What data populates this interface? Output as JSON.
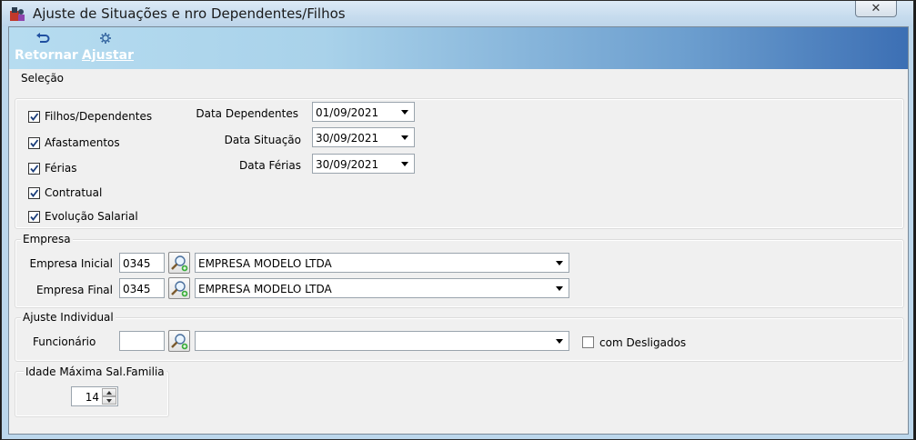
{
  "window": {
    "title": "Ajuste de Situações e nro Dependentes/Filhos",
    "close_glyph": "✕"
  },
  "toolbar": {
    "retornar_label": "Retornar",
    "ajustar_label": "Ajustar",
    "retornar_icon": "undo-arrow-icon",
    "ajustar_icon": "gear-icon"
  },
  "selecao": {
    "legend": "Seleção",
    "checkboxes": [
      {
        "label": "Filhos/Dependentes",
        "checked": true
      },
      {
        "label": "Afastamentos",
        "checked": true
      },
      {
        "label": "Férias",
        "checked": true
      },
      {
        "label": "Contratual",
        "checked": true
      },
      {
        "label": "Evolução Salarial",
        "checked": true
      }
    ],
    "dates": [
      {
        "label": "Data Dependentes",
        "value": "01/09/2021"
      },
      {
        "label": "Data Situação",
        "value": "30/09/2021"
      },
      {
        "label": "Data Férias",
        "value": "30/09/2021"
      }
    ]
  },
  "empresa": {
    "legend": "Empresa",
    "inicial": {
      "label": "Empresa Inicial",
      "code": "0345",
      "name": "EMPRESA MODELO LTDA"
    },
    "final": {
      "label": "Empresa Final",
      "code": "0345",
      "name": "EMPRESA MODELO LTDA"
    }
  },
  "ajuste_individual": {
    "legend": "Ajuste Individual",
    "funcionario_label": "Funcionário",
    "funcionario_code": "",
    "funcionario_name": "",
    "com_desligados_label": "com Desligados",
    "com_desligados_checked": false
  },
  "idade": {
    "legend": "Idade Máxima Sal.Familia",
    "value": "14"
  },
  "colors": {
    "toolbar_start": "#b6dcf0",
    "toolbar_end": "#3c6fb4",
    "window_bg": "#f0f0f0"
  }
}
